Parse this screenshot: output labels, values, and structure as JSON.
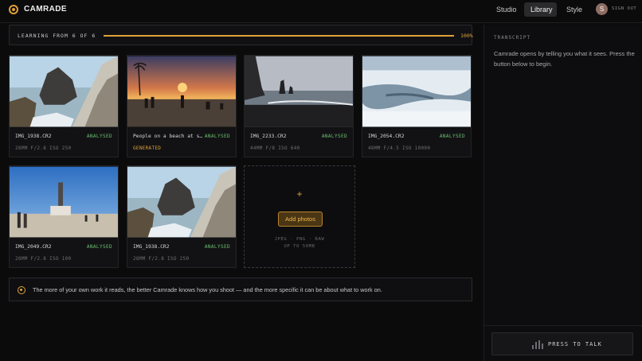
{
  "header": {
    "brand": "CAMRADE",
    "nav": [
      {
        "label": "Studio",
        "active": false
      },
      {
        "label": "Library",
        "active": true
      },
      {
        "label": "Style",
        "active": false
      }
    ],
    "avatar_initial": "S",
    "sign_out": "SIGN OUT"
  },
  "progress": {
    "label": "LEARNING FROM 6 OF 6",
    "percent_text": "100%",
    "percent": 100
  },
  "photos": [
    {
      "name": "IMG_1938.CR2",
      "status": "ANALYSED",
      "meta": "28MM F/2.8 ISO 250",
      "meta_kind": "exif",
      "thumb": "rocky-coast-icon"
    },
    {
      "name": "People on a beach at sunset",
      "status": "ANALYSED",
      "meta": "GENERATED",
      "meta_kind": "generated",
      "thumb": "beach-sunset-icon"
    },
    {
      "name": "IMG_2233.CR2",
      "status": "ANALYSED",
      "meta": "44MM F/8 ISO 640",
      "meta_kind": "exif",
      "thumb": "sea-stacks-icon"
    },
    {
      "name": "IMG_2054.CR2",
      "status": "ANALYSED",
      "meta": "48MM F/4.5 ISO 10000",
      "meta_kind": "exif",
      "thumb": "glacier-icon"
    },
    {
      "name": "IMG_2049.CR2",
      "status": "ANALYSED",
      "meta": "28MM F/2.8 ISO 100",
      "meta_kind": "exif",
      "thumb": "monument-plaza-icon"
    },
    {
      "name": "IMG_1938.CR2",
      "status": "ANALYSED",
      "meta": "28MM F/2.8 ISO 250",
      "meta_kind": "exif",
      "thumb": "rocky-coast-icon"
    }
  ],
  "add_photos": {
    "plus": "+",
    "button": "Add photos",
    "formats": "JPEG · PNG · RAW",
    "limit": "UP TO 50MB"
  },
  "tip": {
    "text": "The more of your own work it reads, the better Camrade knows how you shoot — and the more specific it can be about what to work on."
  },
  "transcript": {
    "heading": "TRANSCRIPT",
    "body": "Camrade opens by telling you what it sees. Press the button below to begin.",
    "talk_button": "PRESS TO TALK"
  },
  "colors": {
    "accent": "#e0a13a",
    "analysed": "#6cc06f",
    "background": "#0b0b0c"
  }
}
